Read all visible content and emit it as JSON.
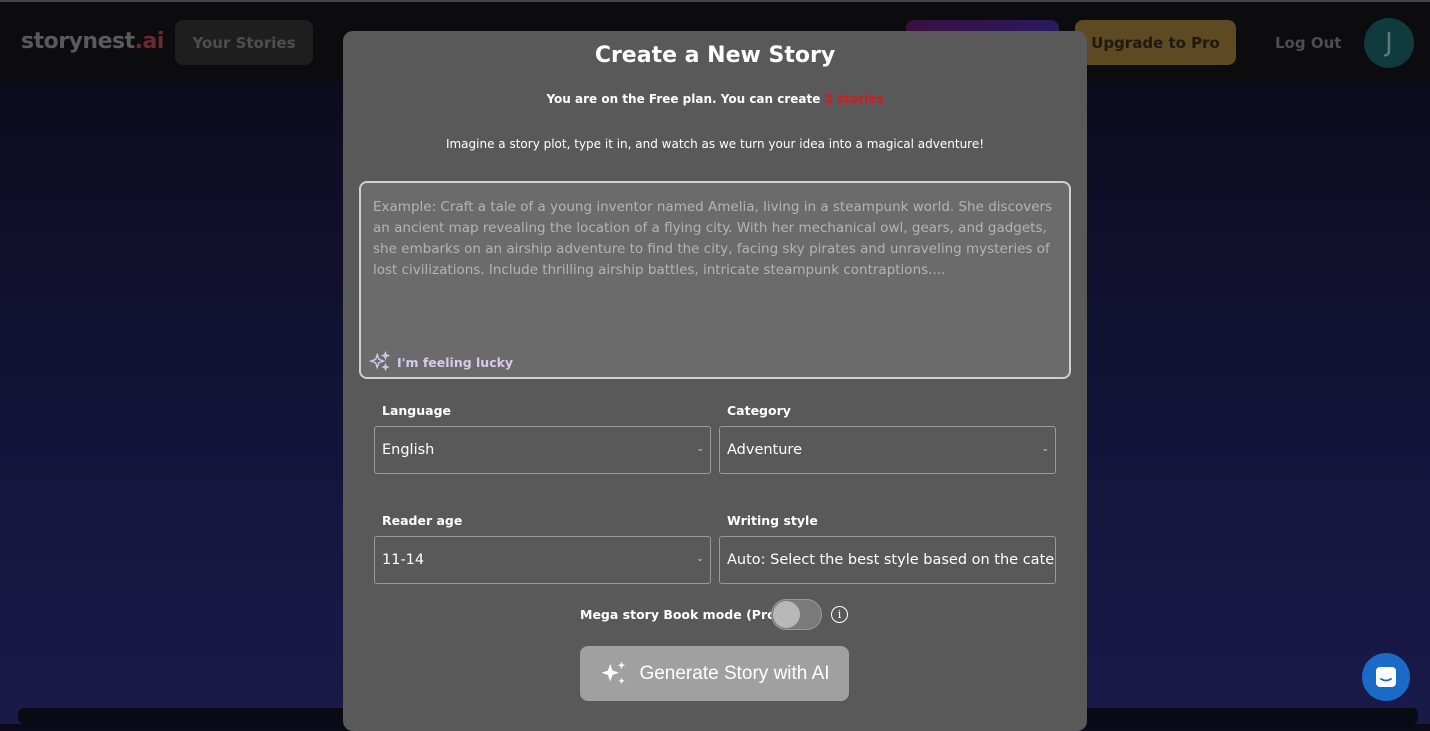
{
  "header": {
    "logo_main": "storynest",
    "logo_suffix": ".ai",
    "your_stories": "Your Stories",
    "upgrade": "Upgrade to Pro",
    "logout": "Log Out",
    "avatar_initial": "J"
  },
  "modal": {
    "title": "Create a New Story",
    "plan_text": "You are on the Free plan. You can create ",
    "plan_highlight": "2 stories",
    "intro": "Imagine a story plot, type it in, and watch as we turn your idea into a magical adventure!",
    "plot_placeholder": "Example: Craft a tale of a young inventor named Amelia, living in a steampunk world. She discovers an ancient map revealing the location of a flying city. With her mechanical owl, gears, and gadgets, she embarks on an airship adventure to find the city, facing sky pirates and unraveling mysteries of lost civilizations. Include thrilling airship battles, intricate steampunk contraptions....",
    "lucky": "I'm feeling lucky",
    "language_label": "Language",
    "language_value": "English",
    "category_label": "Category",
    "category_value": "Adventure",
    "age_label": "Reader age",
    "age_value": "11-14",
    "style_label": "Writing style",
    "style_value": "Auto: Select the best style based on the category and age",
    "mega_label": "Mega story Book mode (Pro)",
    "mega_enabled": false,
    "generate": "Generate Story with AI"
  },
  "colors": {
    "accent_red": "#e01515",
    "upgrade": "#5e4a22",
    "chat": "#1a6ac8"
  }
}
